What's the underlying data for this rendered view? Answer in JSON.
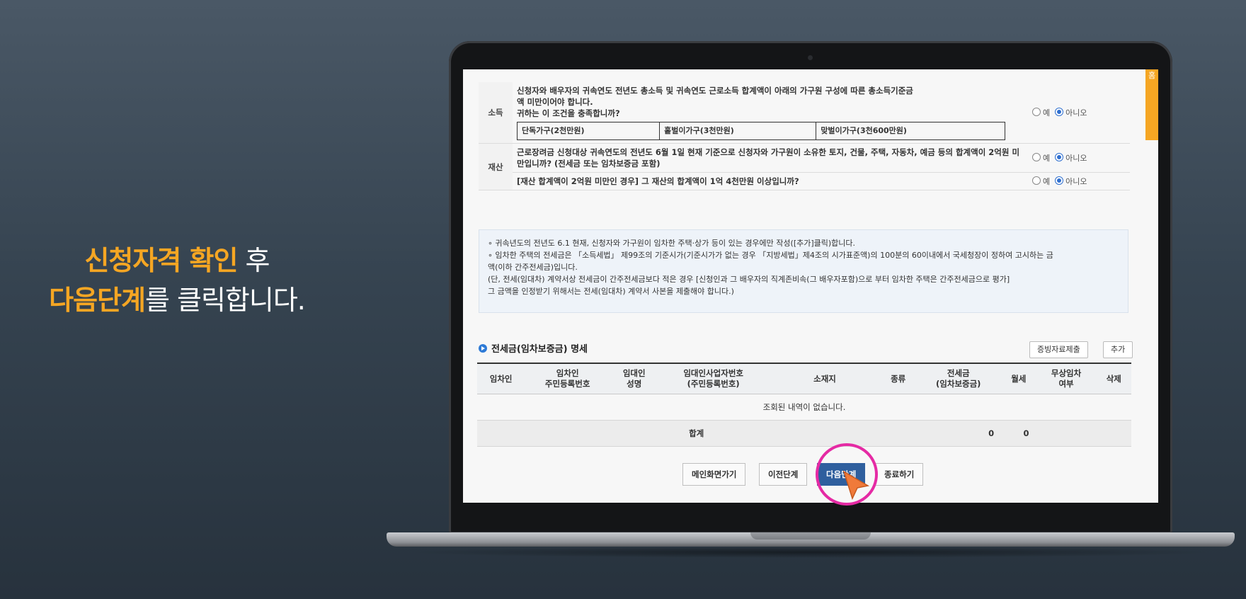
{
  "caption": {
    "line1_highlight": "신청자격 확인",
    "line1_rest": " 후",
    "line2_highlight": "다음단계",
    "line2_rest": "를 클릭합니다."
  },
  "side_tab": {
    "label": "홈"
  },
  "income": {
    "label": "소득",
    "question_line1": "신청자와 배우자의 귀속연도 전년도 총소득 및 귀속연도 근로소득 합계액이 아래의 가구원 구성에 따른 총소득기준금",
    "question_line2": "액 미만이어야 합니다.",
    "question_line3": "귀하는 이 조건을 충족합니까?",
    "households": [
      "단독가구(2천만원)",
      "홑벌이가구(3천만원)",
      "맞벌이가구(3천600만원)"
    ],
    "yes": "예",
    "no": "아니오"
  },
  "property": {
    "label": "재산",
    "question1": "근로장려금 신청대상 귀속연도의 전년도 6월 1일 현재 기준으로 신청자와 가구원이 소유한 토지, 건물, 주택, 자동차, 예금 등의 합계액이 2억원 미만입니까? (전세금 또는 임차보증금 포함)",
    "question2": "[재산 합계액이 2억원 미만인 경우] 그 재산의 합계액이 1억 4천만원 이상입니까?",
    "yes": "예",
    "no": "아니오"
  },
  "notes": {
    "n1": "∘ 귀속년도의 전년도 6.1 현재, 신청자와 가구원이 임차한 주택·상가 등이 있는 경우에만 작성([추가]클릭)합니다.",
    "n2": "∘ 임차한 주택의 전세금은 「소득세법」 제99조의 기준시가(기준시가가 없는 경우 「지방세법」제4조의 시가표준액)의 100분의 60이내에서 국세청장이 정하여 고시하는 금",
    "n3": "  액(이하 간주전세금)입니다.",
    "n4": "  (단, 전세(임대차) 계약서상 전세금이 간주전세금보다 적은 경우 [신청인과 그 배우자의 직계존비속(그 배우자포함)으로 부터 임차한 주택은 간주전세금으로 평가]",
    "n5": "  그 금액을 인정받기 위해서는 전세(임대차) 계약서 사본을 제출해야 합니다.)"
  },
  "section": {
    "title": "전세금(임차보증금) 명세",
    "evidence_button": "증빙자료제출",
    "add_button": "추가"
  },
  "grid": {
    "headers": [
      {
        "l1": "임차인",
        "l2": ""
      },
      {
        "l1": "임차인",
        "l2": "주민등록번호"
      },
      {
        "l1": "임대인",
        "l2": "성명"
      },
      {
        "l1": "임대인사업자번호",
        "l2": "(주민등록번호)"
      },
      {
        "l1": "소재지",
        "l2": ""
      },
      {
        "l1": "종류",
        "l2": ""
      },
      {
        "l1": "전세금",
        "l2": "(임차보증금)"
      },
      {
        "l1": "월세",
        "l2": ""
      },
      {
        "l1": "무상임차",
        "l2": "여부"
      },
      {
        "l1": "삭제",
        "l2": ""
      }
    ],
    "empty_message": "조회된 내역이 없습니다.",
    "sum_label": "합계",
    "sum_deposit": "0",
    "sum_monthly": "0"
  },
  "buttons": {
    "main": "메인화면가기",
    "prev": "이전단계",
    "next": "다음단계",
    "finish": "종료하기"
  },
  "colors": {
    "accent": "#f5a623",
    "primary_button": "#2f5f9e",
    "cursor_ring": "#e52aa4",
    "cursor_arrow": "#f07a3a"
  }
}
